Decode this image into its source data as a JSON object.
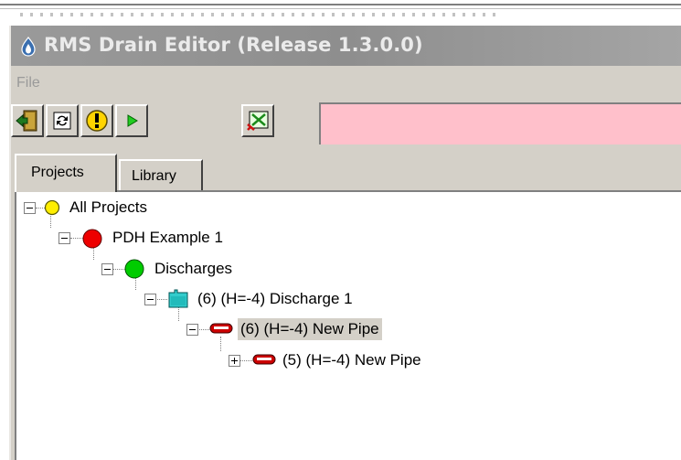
{
  "window": {
    "title": "RMS Drain Editor (Release 1.3.0.0)"
  },
  "menu": {
    "file": "File"
  },
  "toolbar": {
    "buttons": [
      {
        "icon": "exit-door-icon"
      },
      {
        "icon": "refresh-icon"
      },
      {
        "icon": "warning-icon"
      },
      {
        "icon": "play-icon"
      },
      {
        "icon": "network-icon"
      }
    ],
    "status_color": "#ffc0cb"
  },
  "tabs": {
    "projects": "Projects",
    "library": "Library"
  },
  "tree": {
    "root": "All Projects",
    "project": "PDH Example 1",
    "discharges": "Discharges",
    "discharge1": "(6) (H=-4) Discharge 1",
    "pipe1": "(6) (H=-4) New Pipe",
    "pipe2": "(5) (H=-4) New Pipe"
  },
  "colors": {
    "status_ok": "#00cc00",
    "status_error": "#ee0000",
    "status_pending": "#ffee00",
    "selection": "#d4d0c8"
  }
}
